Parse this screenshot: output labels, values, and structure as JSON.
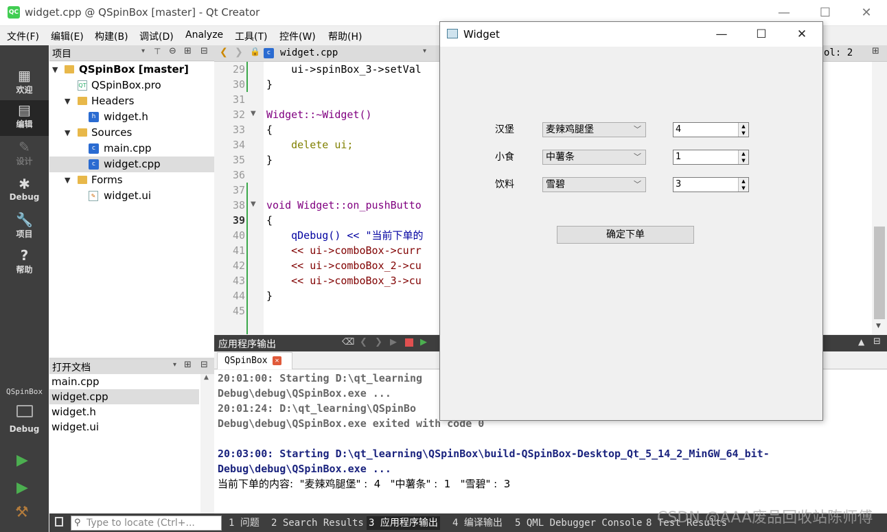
{
  "window": {
    "title": "widget.cpp @ QSpinBox [master] - Qt Creator",
    "app_icon": "QC",
    "minimize": "—",
    "maximize": "☐",
    "close": "✕"
  },
  "menubar": {
    "items": [
      "文件(F)",
      "编辑(E)",
      "构建(B)",
      "调试(D)",
      "Analyze",
      "工具(T)",
      "控件(W)",
      "帮助(H)"
    ]
  },
  "modes": [
    {
      "label": "欢迎",
      "icon": "welcome-grid-icon"
    },
    {
      "label": "编辑",
      "icon": "edit-doc-icon",
      "active": true
    },
    {
      "label": "设计",
      "icon": "design-pen-icon",
      "disabled": true
    },
    {
      "label": "Debug",
      "icon": "debug-bug-icon"
    },
    {
      "label": "项目",
      "icon": "wrench-icon"
    },
    {
      "label": "帮助",
      "icon": "help-icon"
    }
  ],
  "kit": {
    "project": "QSpinBox",
    "build": "Debug"
  },
  "project_pane": {
    "title": "项目",
    "tree": [
      {
        "label": "QSpinBox [master]",
        "level": 0,
        "type": "project",
        "expanded": true
      },
      {
        "label": "QSpinBox.pro",
        "level": 1,
        "type": "pro"
      },
      {
        "label": "Headers",
        "level": 1,
        "type": "folder",
        "expanded": true
      },
      {
        "label": "widget.h",
        "level": 2,
        "type": "header"
      },
      {
        "label": "Sources",
        "level": 1,
        "type": "folder",
        "expanded": true
      },
      {
        "label": "main.cpp",
        "level": 2,
        "type": "source"
      },
      {
        "label": "widget.cpp",
        "level": 2,
        "type": "source",
        "selected": true
      },
      {
        "label": "Forms",
        "level": 1,
        "type": "folder",
        "expanded": true
      },
      {
        "label": "widget.ui",
        "level": 2,
        "type": "form"
      }
    ]
  },
  "open_docs": {
    "title": "打开文档",
    "items": [
      "main.cpp",
      "widget.cpp",
      "widget.h",
      "widget.ui"
    ],
    "selected": "widget.cpp"
  },
  "editor": {
    "tab": "widget.cpp",
    "column_indicator": "ol: 2",
    "current_line": "39",
    "lines": [
      {
        "n": "29",
        "code": "    ui->spinBox_3->setVal"
      },
      {
        "n": "30",
        "code": "}"
      },
      {
        "n": "31",
        "code": ""
      },
      {
        "n": "32",
        "code": "Widget::~Widget()"
      },
      {
        "n": "33",
        "code": "{"
      },
      {
        "n": "34",
        "code": "    delete ui;"
      },
      {
        "n": "35",
        "code": "}"
      },
      {
        "n": "36",
        "code": ""
      },
      {
        "n": "37",
        "code": ""
      },
      {
        "n": "38",
        "code": "void Widget::on_pushButto"
      },
      {
        "n": "39",
        "code": "{"
      },
      {
        "n": "40",
        "code": "    qDebug() << \"当前下单的"
      },
      {
        "n": "41",
        "code": "    << ui->comboBox->curr"
      },
      {
        "n": "42",
        "code": "    << ui->comboBox_2->cu"
      },
      {
        "n": "43",
        "code": "    << ui->comboBox_3->cu"
      },
      {
        "n": "44",
        "code": "}"
      },
      {
        "n": "45",
        "code": ""
      }
    ]
  },
  "output_pane": {
    "title": "应用程序输出",
    "tab": "QSpinBox",
    "lines": [
      "20:01:00: Starting D:\\qt_learning",
      "Debug\\debug\\QSpinBox.exe ...",
      "20:01:24: D:\\qt_learning\\QSpinBo",
      "Debug\\debug\\QSpinBox.exe exited with code 0",
      "",
      "20:03:00: Starting D:\\qt_learning\\QSpinBox\\build-QSpinBox-Desktop_Qt_5_14_2_MinGW_64_bit-",
      "Debug\\debug\\QSpinBox.exe ...",
      "当前下单的内容:  \"麦辣鸡腿堡\" :  4   \"中薯条\" :  1   \"雪碧\" :  3"
    ]
  },
  "statusbar": {
    "locator_placeholder": "Type to locate (Ctrl+...",
    "tabs": [
      "1 问题",
      "2 Search Results",
      "3 应用程序输出",
      "4 编译输出",
      "5 QML Debugger Console",
      "8 Test Results"
    ],
    "active_tab": "3 应用程序输出"
  },
  "watermark": "CSDN @AAA废品回收站陈师傅",
  "dialog": {
    "title": "Widget",
    "rows": [
      {
        "label": "汉堡",
        "combo": "麦辣鸡腿堡",
        "spin": "4"
      },
      {
        "label": "小食",
        "combo": "中薯条",
        "spin": "1"
      },
      {
        "label": "饮料",
        "combo": "雪碧",
        "spin": "3"
      }
    ],
    "button": "确定下单"
  }
}
